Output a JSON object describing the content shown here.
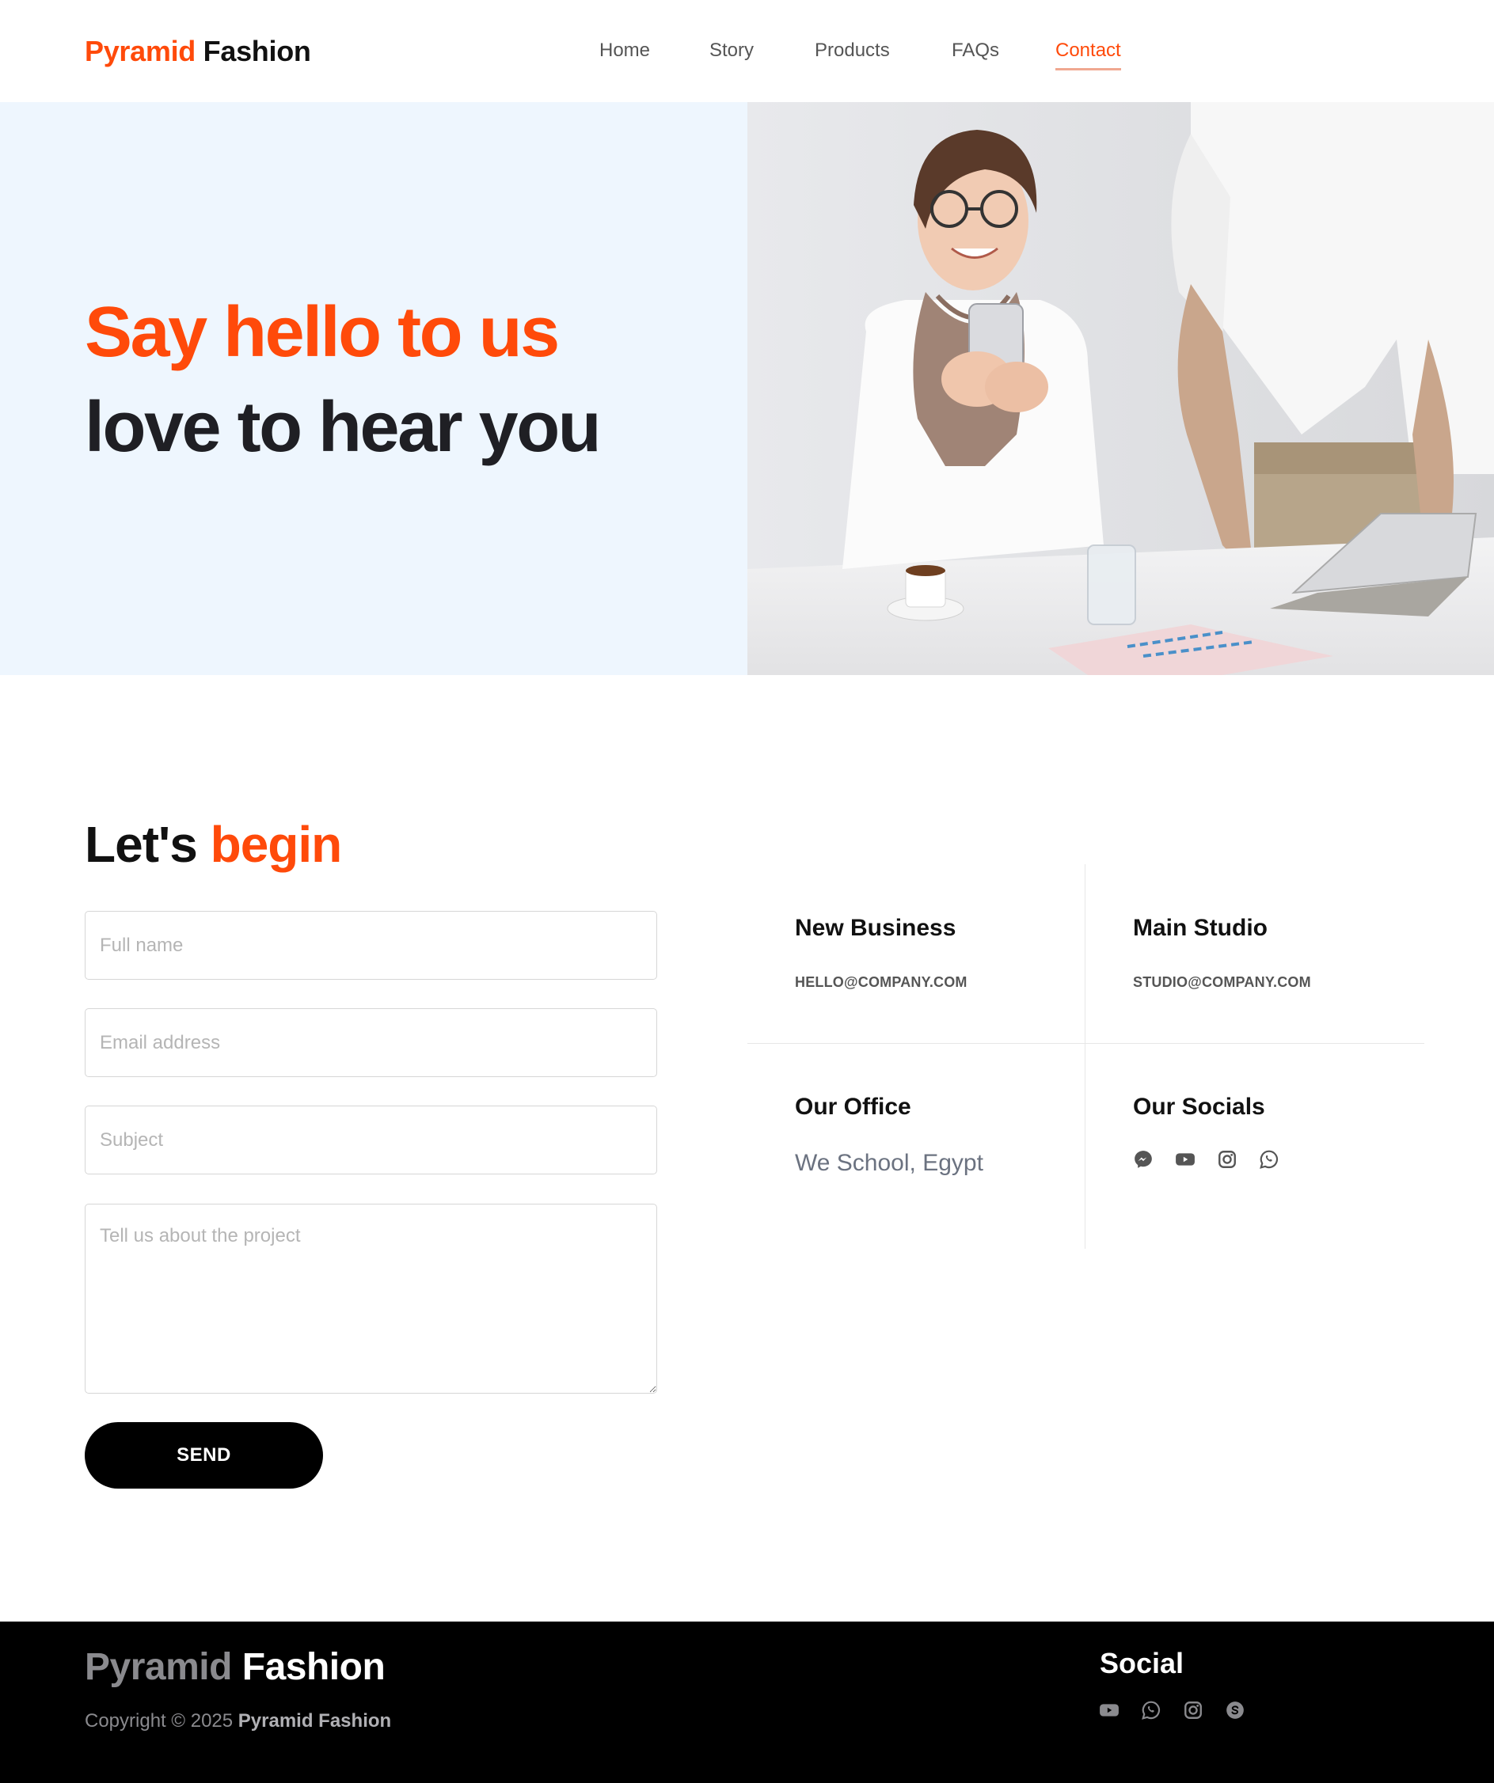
{
  "brand": {
    "part1": "Pyramid",
    "part2": "Fashion"
  },
  "nav": {
    "items": [
      {
        "label": "Home"
      },
      {
        "label": "Story"
      },
      {
        "label": "Products"
      },
      {
        "label": "FAQs"
      },
      {
        "label": "Contact"
      }
    ],
    "active": "Contact"
  },
  "hero": {
    "line1": "Say hello to us",
    "line2": "love to hear you"
  },
  "form": {
    "title_part1": "Let's",
    "title_part2": "begin",
    "fullname_placeholder": "Full name",
    "email_placeholder": "Email address",
    "subject_placeholder": "Subject",
    "message_placeholder": "Tell us about the project",
    "send_label": "SEND"
  },
  "info": {
    "new_business": {
      "title": "New Business",
      "email": "HELLO@COMPANY.COM"
    },
    "main_studio": {
      "title": "Main Studio",
      "email": "STUDIO@COMPANY.COM"
    },
    "office": {
      "title": "Our Office",
      "address": "We School, Egypt"
    },
    "socials": {
      "title": "Our Socials",
      "icons": [
        "messenger-icon",
        "youtube-icon",
        "instagram-icon",
        "whatsapp-icon"
      ]
    }
  },
  "footer": {
    "copyright_prefix": "Copyright © 2025",
    "copyright_brand": "Pyramid Fashion",
    "social_title": "Social",
    "social_icons": [
      "youtube-icon",
      "whatsapp-icon",
      "instagram-icon",
      "skype-icon"
    ]
  },
  "colors": {
    "accent": "#ff4a0a",
    "hero_bg": "#eef6fe",
    "dark_text": "#1f1f24",
    "footer_bg": "#000000",
    "icon_gray": "#555555"
  }
}
